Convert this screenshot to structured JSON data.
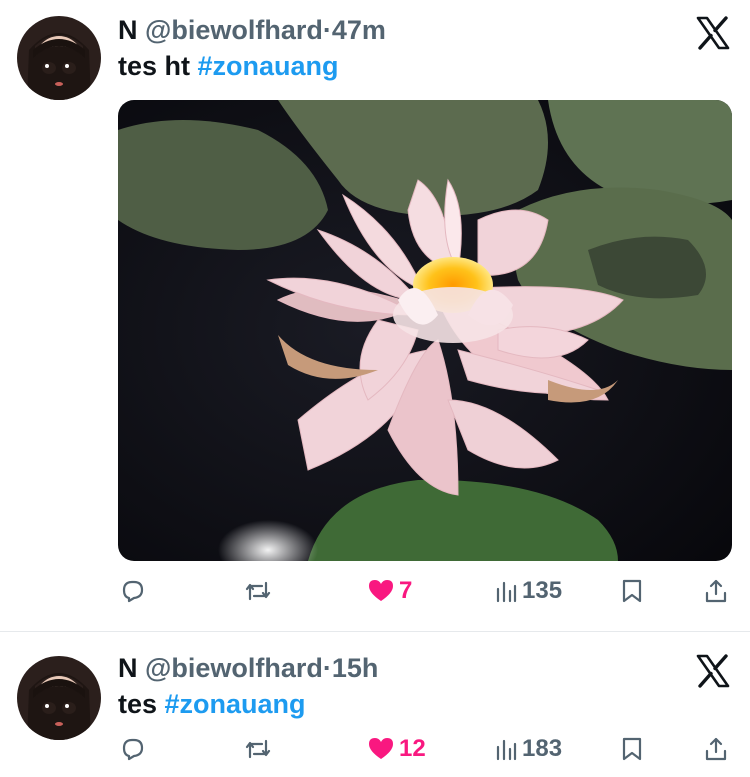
{
  "tweets": [
    {
      "display_name": "N",
      "handle": "@biewolfhard",
      "sep": "·",
      "time": "47m",
      "text": "tes ht ",
      "hashtag": "#zonauang",
      "has_media": true,
      "stats": {
        "replies": "",
        "retweets": "",
        "likes": "7",
        "views": "135"
      },
      "liked": true
    },
    {
      "display_name": "N",
      "handle": "@biewolfhard",
      "sep": "·",
      "time": "15h",
      "text": "tes ",
      "hashtag": "#zonauang",
      "has_media": false,
      "stats": {
        "replies": "",
        "retweets": "",
        "likes": "12",
        "views": "183"
      },
      "liked": true
    }
  ],
  "colors": {
    "accent": "#1d9bf0",
    "like": "#f91880",
    "muted": "#536471",
    "text": "#0f1419"
  },
  "icons": [
    "x-logo-icon",
    "reply-icon",
    "retweet-icon",
    "heart-icon",
    "views-icon",
    "bookmark-icon",
    "share-icon"
  ]
}
